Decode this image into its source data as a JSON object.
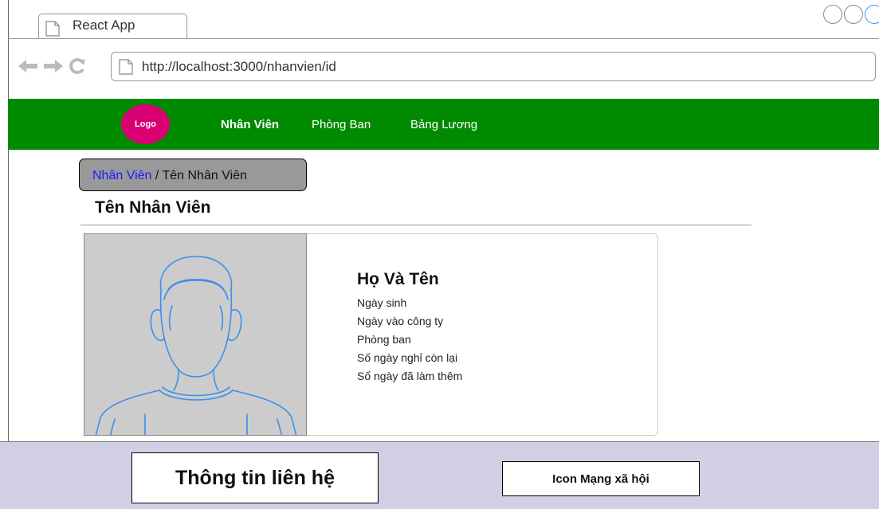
{
  "browser": {
    "tab_title": "React App",
    "url": "http://localhost:3000/nhanvien/id",
    "icons": [
      "back-arrow-icon",
      "forward-arrow-icon",
      "reload-icon",
      "page-icon"
    ]
  },
  "navbar": {
    "logo": "Logo",
    "links": [
      "Nhân Viên",
      "Phòng Ban",
      "Bảng Lương"
    ],
    "active": "Nhân Viên",
    "background": "#008a00",
    "logo_color": "#d80073"
  },
  "breadcrumb": {
    "link": "Nhân Viên",
    "separator": " / ",
    "current": "Tên Nhân Viên"
  },
  "page": {
    "title": "Tên Nhân Viên"
  },
  "employee": {
    "name": "Họ Và Tên",
    "fields": [
      "Ngày sinh",
      "Ngày vào công ty",
      "Phòng ban",
      "Số ngày nghỉ còn lại",
      "Số ngày đã làm thêm"
    ]
  },
  "footer": {
    "contact": "Thông tin liên hệ",
    "social": "Icon Mạng xã hội",
    "background": "#d0cfe3"
  }
}
